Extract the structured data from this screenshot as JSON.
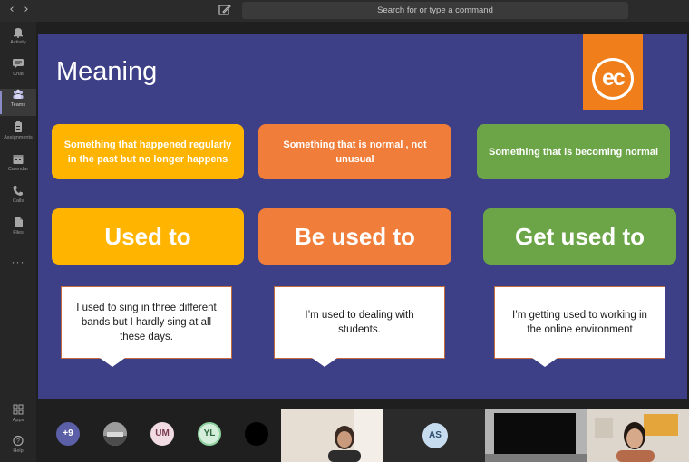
{
  "topbar": {
    "back_glyph": "‹",
    "forward_glyph": "›",
    "search_placeholder": "Search for or type a command"
  },
  "rail": {
    "items": [
      {
        "label": "Activity",
        "icon": "bell-icon"
      },
      {
        "label": "Chat",
        "icon": "chat-icon"
      },
      {
        "label": "Teams",
        "icon": "teams-icon",
        "active": true
      },
      {
        "label": "Assignments",
        "icon": "assignments-icon"
      },
      {
        "label": "Calendar",
        "icon": "calendar-icon"
      },
      {
        "label": "Calls",
        "icon": "phone-icon"
      },
      {
        "label": "Files",
        "icon": "file-icon"
      }
    ],
    "more": "···",
    "bottom_items": [
      {
        "label": "Apps",
        "icon": "apps-icon"
      },
      {
        "label": "Help",
        "icon": "help-icon"
      }
    ]
  },
  "slide": {
    "title": "Meaning",
    "logo_text": "ec",
    "colors": {
      "background": "#3d3f87",
      "yellow": "#ffb400",
      "orange": "#f07e3a",
      "green": "#6ba547",
      "logo": "#f07e1a"
    },
    "definitions": [
      "Something that happened regularly in the past but no longer happens",
      "Something that is normal , not unusual",
      "Something that is becoming normal"
    ],
    "phrases": [
      "Used to",
      "Be used to",
      "Get used to"
    ],
    "examples": [
      "I used to sing in three different bands but I hardly sing at all these days.",
      "I’m used to dealing with students.",
      "I’m getting used to working in the online environment"
    ]
  },
  "participants": {
    "overflow": "+9",
    "initials": [
      "UM",
      "YL",
      "AS"
    ]
  }
}
